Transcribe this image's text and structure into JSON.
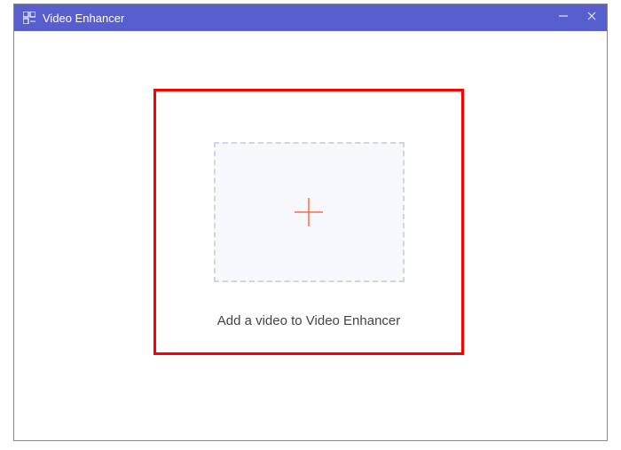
{
  "titlebar": {
    "app_title": "Video Enhancer"
  },
  "dropzone": {
    "instruction": "Add a video to Video Enhancer"
  },
  "colors": {
    "titlebar_bg": "#575fcf",
    "highlight_border": "#ff0000",
    "plus_color": "#ff6b4a",
    "dashed_border": "#d0d4e4"
  }
}
